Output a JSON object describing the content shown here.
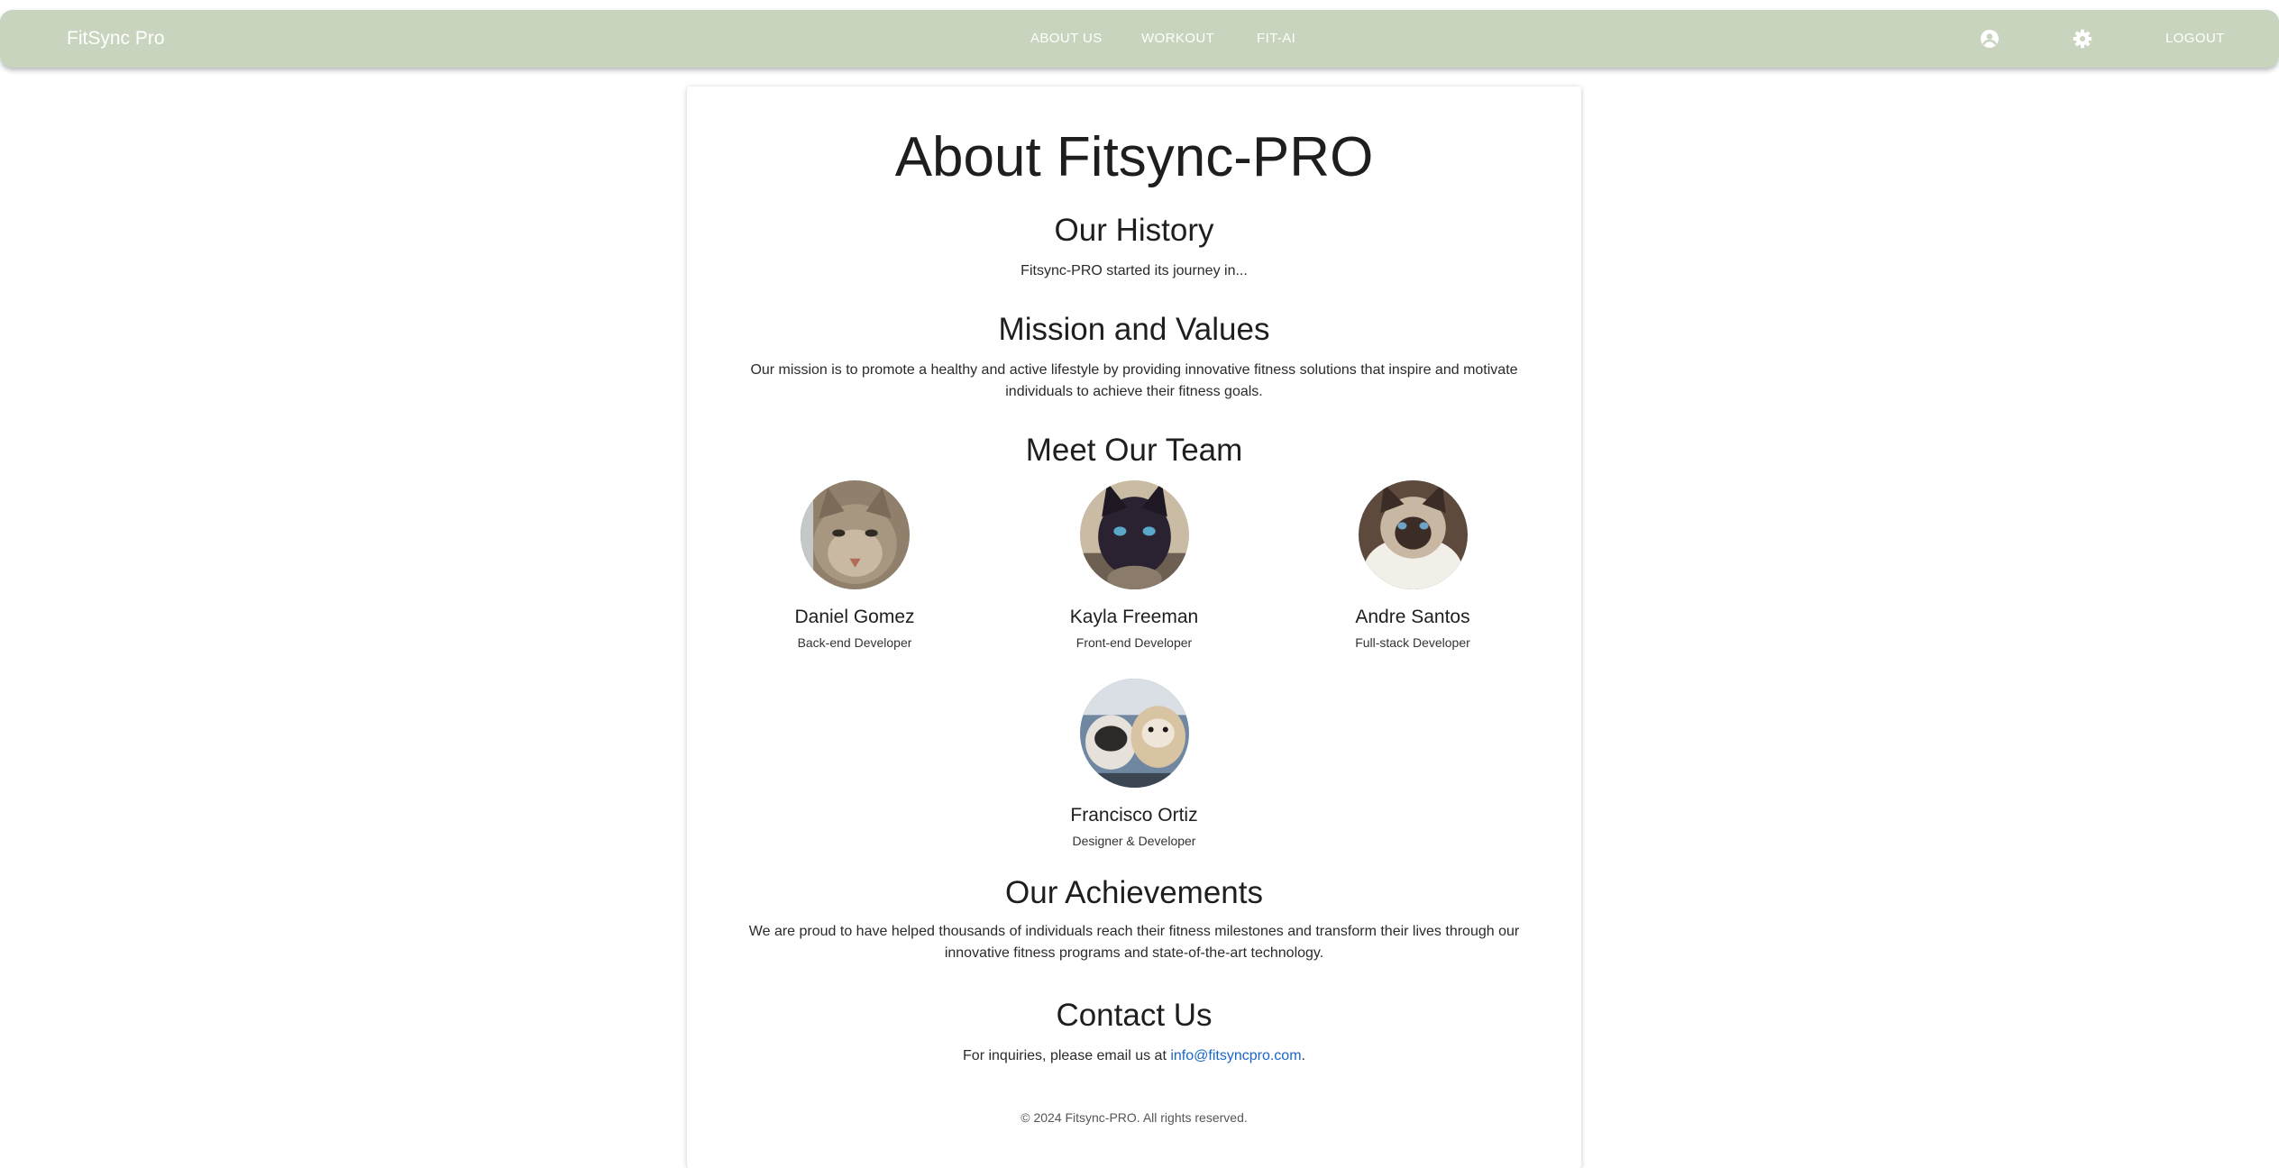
{
  "navbar": {
    "brand": "FitSync Pro",
    "links": [
      "ABOUT US",
      "WORKOUT",
      "FIT-AI"
    ],
    "account_icon": "account-circle-icon",
    "settings_icon": "gear-icon",
    "logout": "LOGOUT",
    "color": "#c8d4bd"
  },
  "page": {
    "title": "About Fitsync-PRO",
    "history": {
      "heading": "Our History",
      "text": "Fitsync-PRO started its journey in..."
    },
    "mission": {
      "heading": "Mission and Values",
      "line1": "Our mission is to promote a healthy and active lifestyle by providing innovative fitness solutions that inspire and motivate",
      "line2": "individuals to achieve their fitness goals."
    },
    "team": {
      "heading": "Meet Our Team",
      "members": [
        {
          "name": "Daniel Gomez",
          "role": "Back-end Developer"
        },
        {
          "name": "Kayla Freeman",
          "role": "Front-end Developer"
        },
        {
          "name": "Andre Santos",
          "role": "Full-stack Developer"
        },
        {
          "name": "Francisco Ortiz",
          "role": "Designer & Developer"
        }
      ]
    },
    "achievements": {
      "heading": "Our Achievements",
      "line1": "We are proud to have helped thousands of individuals reach their fitness milestones and transform their lives through our",
      "line2": "innovative fitness programs and state-of-the-art technology."
    },
    "contact": {
      "heading": "Contact Us",
      "text": "For inquiries, please email us at ",
      "email": "info@fitsyncpro.com",
      "suffix": "."
    },
    "footer": "© 2024 Fitsync-PRO. All rights reserved."
  }
}
